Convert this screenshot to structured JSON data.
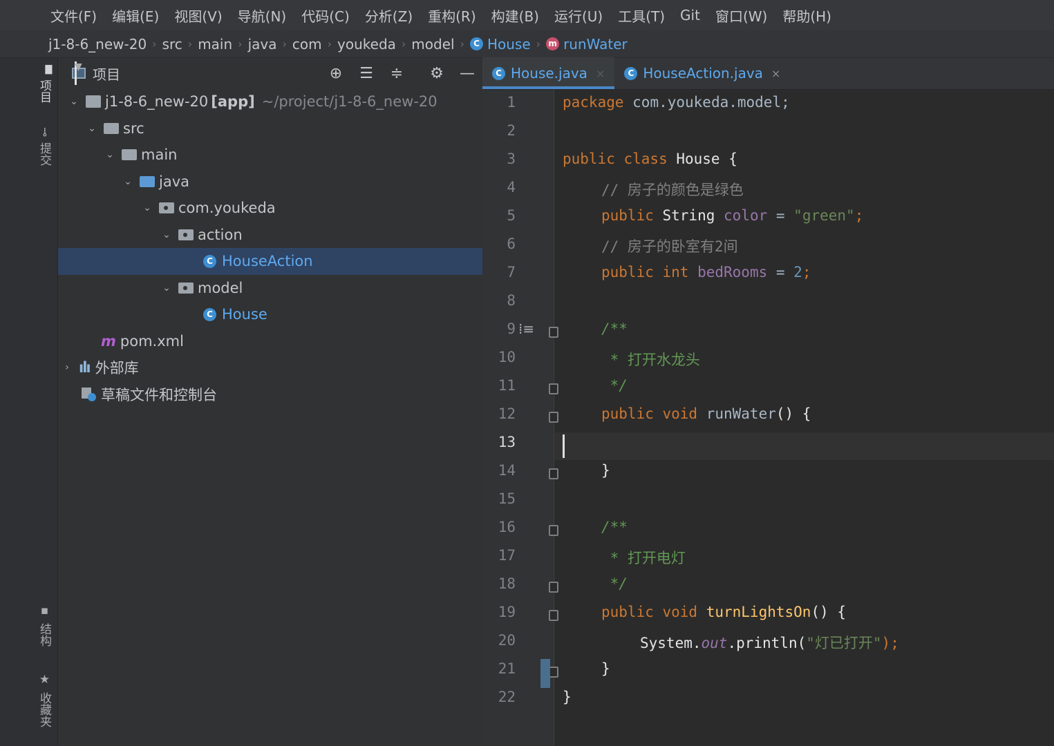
{
  "menu": [
    "文件(F)",
    "编辑(E)",
    "视图(V)",
    "导航(N)",
    "代码(C)",
    "分析(Z)",
    "重构(R)",
    "构建(B)",
    "运行(U)",
    "工具(T)",
    "Git",
    "窗口(W)",
    "帮助(H)"
  ],
  "breadcrumb": {
    "items": [
      "j1-8-6_new-20",
      "src",
      "main",
      "java",
      "com",
      "youkeda",
      "model"
    ],
    "class_name": "House",
    "method_name": "runWater",
    "class_icon_letter": "C",
    "method_icon_letter": "m"
  },
  "tool_strip": {
    "project": "项目",
    "commit": "提交",
    "structure": "结构",
    "favorites": "收藏夹"
  },
  "project_panel": {
    "title": "项目",
    "tools": [
      "locate-icon",
      "expand-all-icon",
      "collapse-all-icon",
      "gear-icon",
      "minimize-icon"
    ],
    "tree": {
      "module": "j1-8-6_new-20",
      "module_tag": "[app]",
      "module_path": "~/project/j1-8-6_new-20",
      "src": "src",
      "main": "main",
      "java": "java",
      "package": "com.youkeda",
      "action": "action",
      "house_action": "HouseAction",
      "model": "model",
      "house": "House",
      "pom": "pom.xml",
      "external_libs": "外部库",
      "scratches": "草稿文件和控制台"
    }
  },
  "tabs": [
    {
      "label": "House.java",
      "active": true
    },
    {
      "label": "HouseAction.java",
      "active": false
    }
  ],
  "editor": {
    "current_line": 13,
    "line_numbers": [
      "1",
      "2",
      "3",
      "4",
      "5",
      "6",
      "7",
      "8",
      "9",
      "10",
      "11",
      "12",
      "13",
      "14",
      "15",
      "16",
      "17",
      "18",
      "19",
      "20",
      "21",
      "22"
    ],
    "code": {
      "l1_kw": "package",
      "l1_rest": " com.youkeda.model;",
      "l3_kw": "public class",
      "l3_rest": " House {",
      "l4": "// 房子的颜色是绿色",
      "l5_kw": "public",
      "l5_type": " String ",
      "l5_field": "color",
      "l5_eq": " = ",
      "l5_str": "\"green\"",
      "l5_end": ";",
      "l6": "// 房子的卧室有2间",
      "l7_kw": "public int",
      "l7_field": " bedRooms",
      "l7_eq": " = ",
      "l7_num": "2",
      "l7_end": ";",
      "l9": "/**",
      "l10": " * 打开水龙头",
      "l11": " */",
      "l12_kw": "public void",
      "l12_name": " runWater",
      "l12_end": "() {",
      "l14": "}",
      "l16": "/**",
      "l17": " * 打开电灯",
      "l18": " */",
      "l19_kw": "public void",
      "l19_name": " turnLightsOn",
      "l19_end": "() {",
      "l20_a": "System.",
      "l20_out": "out",
      "l20_b": ".println(",
      "l20_str": "\"灯已打开\"",
      "l20_end": ");",
      "l21": "}",
      "l22": "}"
    }
  }
}
